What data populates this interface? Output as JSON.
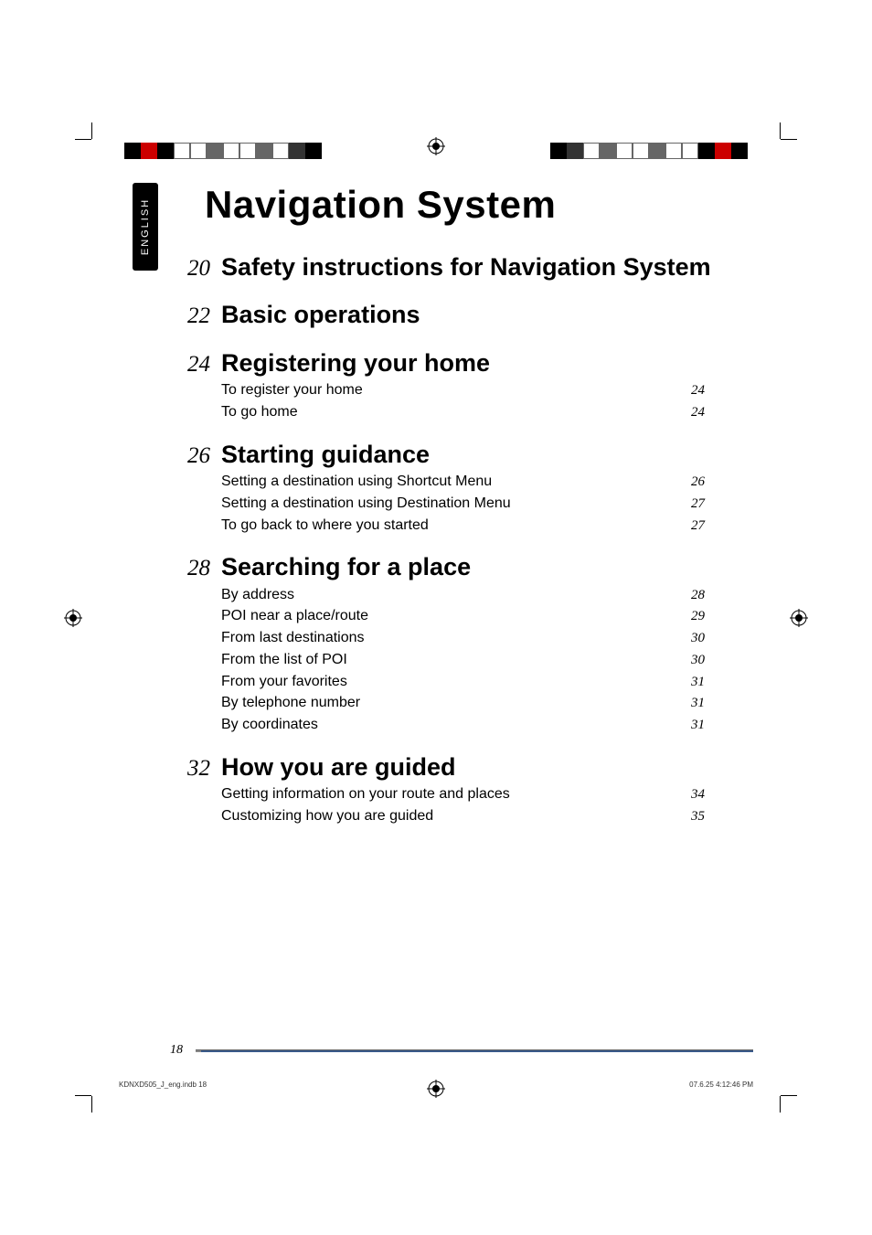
{
  "side_tab": "ENGLISH",
  "title": "Navigation System",
  "toc": [
    {
      "page": "20",
      "title": "Safety instructions for Navigation System",
      "subs": []
    },
    {
      "page": "22",
      "title": "Basic operations",
      "subs": []
    },
    {
      "page": "24",
      "title": "Registering your home",
      "subs": [
        {
          "label": "To register your home",
          "page": "24"
        },
        {
          "label": "To go home",
          "page": "24"
        }
      ]
    },
    {
      "page": "26",
      "title": "Starting guidance",
      "subs": [
        {
          "label": "Setting a destination using Shortcut Menu",
          "page": "26"
        },
        {
          "label": "Setting a destination using Destination Menu",
          "page": "27"
        },
        {
          "label": "To go back to where you started",
          "page": "27"
        }
      ]
    },
    {
      "page": "28",
      "title": "Searching for a place",
      "subs": [
        {
          "label": "By address",
          "page": "28"
        },
        {
          "label": "POI near a place/route",
          "page": "29"
        },
        {
          "label": "From last destinations",
          "page": "30"
        },
        {
          "label": "From the list of POI",
          "page": "30"
        },
        {
          "label": "From your favorites",
          "page": "31"
        },
        {
          "label": "By telephone number",
          "page": "31"
        },
        {
          "label": "By coordinates",
          "page": "31"
        }
      ]
    },
    {
      "page": "32",
      "title": "How you are guided",
      "subs": [
        {
          "label": "Getting information on your route and places",
          "page": "34"
        },
        {
          "label": "Customizing how you are guided",
          "page": "35"
        }
      ]
    }
  ],
  "page_number": "18",
  "print_meta_left": "KDNXD505_J_eng.indb   18",
  "print_meta_right": "07.6.25   4:12:46 PM",
  "colorbar_left": [
    "#000",
    "#c00",
    "#000",
    "#fff",
    "#fff",
    "#666",
    "#fff",
    "#fff",
    "#666",
    "#fff",
    "#333",
    "#000"
  ],
  "colorbar_right": [
    "#000",
    "#c00",
    "#000",
    "#fff",
    "#fff",
    "#666",
    "#fff",
    "#fff",
    "#666",
    "#fff",
    "#333",
    "#000"
  ]
}
